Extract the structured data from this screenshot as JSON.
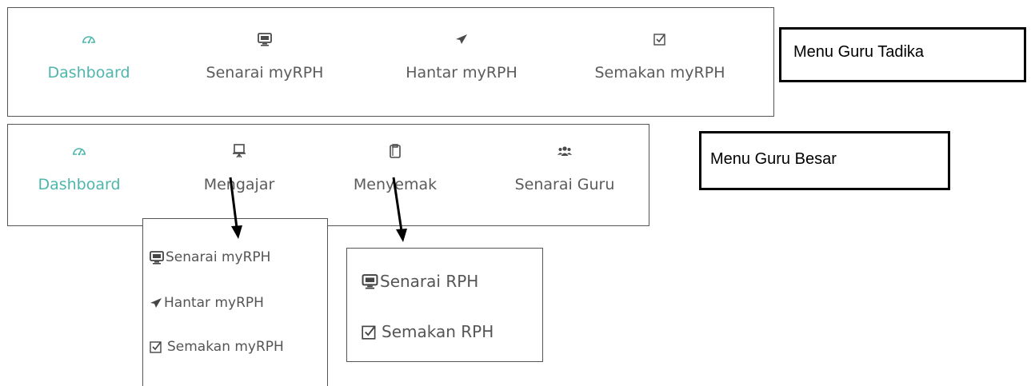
{
  "menu_tadika": {
    "items": [
      {
        "label": "Dashboard",
        "icon": "dashboard-icon",
        "active": true
      },
      {
        "label": "Senarai myRPH",
        "icon": "monitor-icon"
      },
      {
        "label": "Hantar myRPH",
        "icon": "paper-plane-icon"
      },
      {
        "label": "Semakan myRPH",
        "icon": "checkbox-icon"
      }
    ],
    "caption": "Menu Guru Tadika"
  },
  "menu_besar": {
    "items": [
      {
        "label": "Dashboard",
        "icon": "dashboard-icon",
        "active": true
      },
      {
        "label": "Mengajar",
        "icon": "presentation-board-icon"
      },
      {
        "label": "Menyemak",
        "icon": "clipboard-icon"
      },
      {
        "label": "Senarai Guru",
        "icon": "users-icon"
      }
    ],
    "caption": "Menu Guru Besar"
  },
  "dropdown_mengajar": {
    "items": [
      {
        "label": "Senarai myRPH",
        "icon": "monitor-icon"
      },
      {
        "label": "Hantar myRPH",
        "icon": "paper-plane-icon"
      },
      {
        "label": "Semakan myRPH",
        "icon": "checkbox-icon"
      }
    ]
  },
  "dropdown_menyemak": {
    "items": [
      {
        "label": "Senarai RPH",
        "icon": "monitor-icon"
      },
      {
        "label": "Semakan RPH",
        "icon": "checkbox-icon"
      }
    ]
  },
  "colors": {
    "active": "#4db6ac",
    "text": "#5b5b5b",
    "border": "#555555"
  }
}
